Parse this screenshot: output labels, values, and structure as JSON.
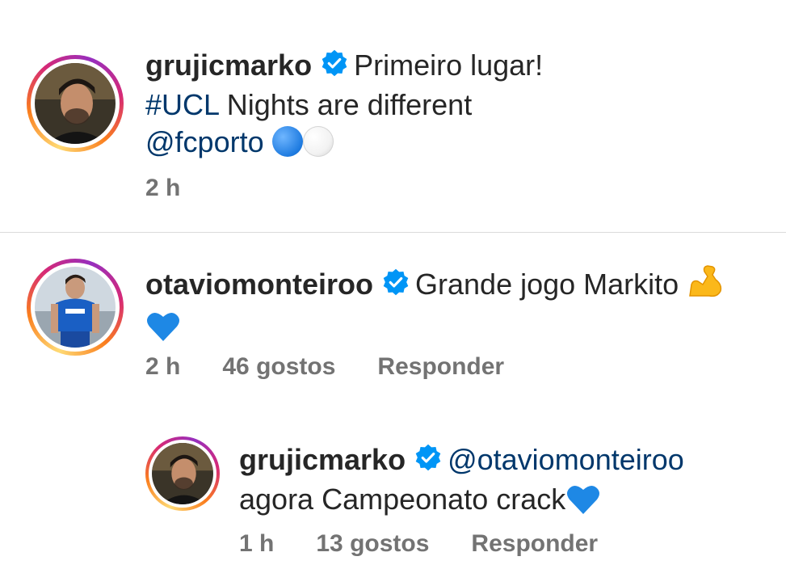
{
  "comments": [
    {
      "username": "grujicmarko",
      "text_part1": "Primeiro lugar!",
      "hashtag": "#UCL",
      "text_part2": " Nights are different",
      "mention": "@fcporto",
      "emojis": [
        "blue-circle",
        "white-circle"
      ],
      "time": "2 h"
    },
    {
      "username": "otaviomonteiroo",
      "text": "Grande jogo Markito",
      "emojis": [
        "flexed-biceps",
        "blue-heart"
      ],
      "time": "2 h",
      "likes": "46 gostos",
      "reply": "Responder"
    }
  ],
  "reply": {
    "username": "grujicmarko",
    "mention": "@otaviomonteiroo",
    "text": "agora Campeonato crack",
    "emojis": [
      "blue-heart"
    ],
    "time": "1 h",
    "likes": "13 gostos",
    "reply": "Responder"
  },
  "colors": {
    "verified": "#0095f6",
    "link": "#00376b",
    "meta": "#737373",
    "text": "#262626"
  }
}
